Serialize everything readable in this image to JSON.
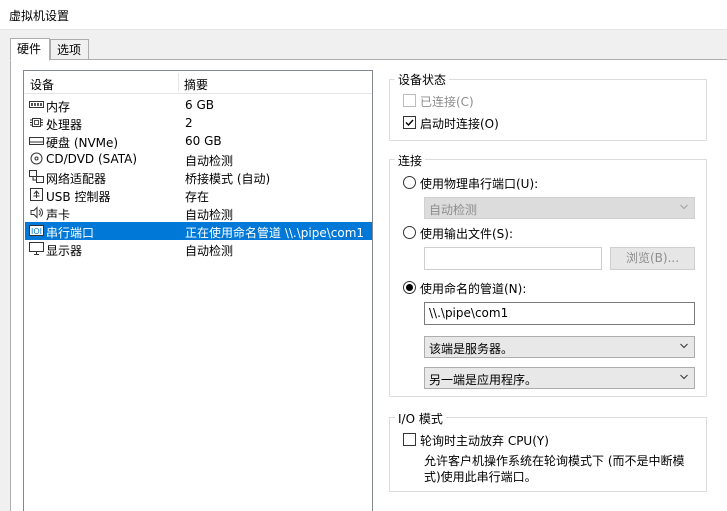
{
  "window": {
    "title": "虚拟机设置"
  },
  "tabs": [
    {
      "label": "硬件"
    },
    {
      "label": "选项"
    }
  ],
  "device_list": {
    "headers": {
      "device": "设备",
      "summary": "摘要"
    },
    "items": [
      {
        "name": "内存",
        "summary": "6 GB",
        "icon": "memory-icon"
      },
      {
        "name": "处理器",
        "summary": "2",
        "icon": "processor-icon"
      },
      {
        "name": "硬盘 (NVMe)",
        "summary": "60 GB",
        "icon": "harddisk-icon"
      },
      {
        "name": "CD/DVD (SATA)",
        "summary": "自动检测",
        "icon": "cd-dvd-icon"
      },
      {
        "name": "网络适配器",
        "summary": "桥接模式 (自动)",
        "icon": "network-adapter-icon"
      },
      {
        "name": "USB 控制器",
        "summary": "存在",
        "icon": "usb-icon"
      },
      {
        "name": "声卡",
        "summary": "自动检测",
        "icon": "sound-card-icon"
      },
      {
        "name": "串行端口",
        "summary": "正在使用命名管道 \\\\.\\pipe\\com1",
        "icon": "serial-port-icon",
        "selected": true
      },
      {
        "name": "显示器",
        "summary": "自动检测",
        "icon": "display-icon"
      }
    ]
  },
  "device_status": {
    "label": "设备状态",
    "connected": {
      "label": "已连接(C)",
      "checked": false,
      "disabled": true
    },
    "connect_at_power_on": {
      "label": "启动时连接(O)",
      "checked": true
    }
  },
  "connection": {
    "label": "连接",
    "physical_port": {
      "label": "使用物理串行端口(U):",
      "selected": false,
      "combo_value": "自动检测"
    },
    "output_file": {
      "label": "使用输出文件(S):",
      "selected": false,
      "browse_label": "浏览(B)..."
    },
    "named_pipe": {
      "label": "使用命名的管道(N):",
      "selected": true,
      "pipe_value": "\\\\.\\pipe\\com1",
      "end_value": "该端是服务器。",
      "other_end_value": "另一端是应用程序。"
    }
  },
  "io_mode": {
    "label": "I/O 模式",
    "yield_cpu": {
      "label": "轮询时主动放弃 CPU(Y)",
      "checked": false
    },
    "description": "允许客户机操作系统在轮询模式下 (而不是中断模式)使用此串行端口。"
  },
  "colors": {
    "accent": "#0078d7",
    "selection_text": "#ffffff"
  }
}
